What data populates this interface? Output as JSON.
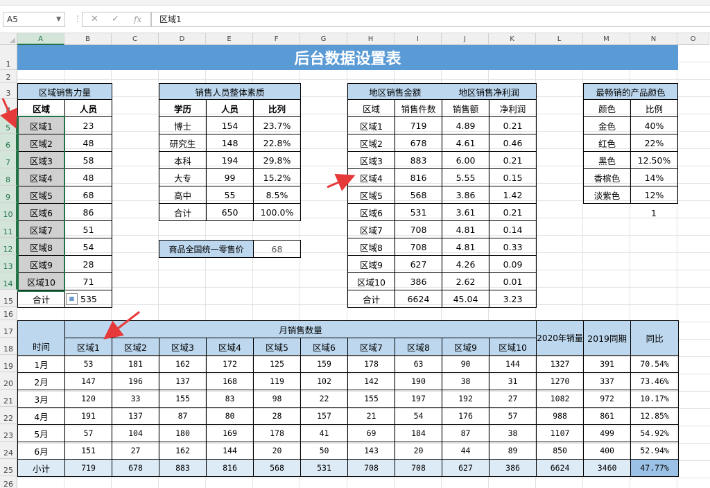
{
  "formula_bar": {
    "name_box": "A5",
    "cancel_icon": "✕",
    "confirm_icon": "✓",
    "fx_icon": "fx",
    "formula": "区域1"
  },
  "columns": [
    "A",
    "B",
    "C",
    "D",
    "E",
    "F",
    "G",
    "H",
    "I",
    "J",
    "K",
    "L",
    "M",
    "N",
    "O"
  ],
  "rows": [
    "1",
    "2",
    "3",
    "4",
    "5",
    "6",
    "7",
    "8",
    "9",
    "10",
    "11",
    "12",
    "13",
    "14",
    "15",
    "16",
    "17",
    "18",
    "19",
    "20",
    "21",
    "22",
    "23",
    "24",
    "25",
    "26"
  ],
  "title": "后台数据设置表",
  "force_table": {
    "title": "区域销售力量",
    "headers": [
      "区域",
      "人员"
    ],
    "rows": [
      [
        "区域1",
        "23"
      ],
      [
        "区域2",
        "48"
      ],
      [
        "区域3",
        "58"
      ],
      [
        "区域4",
        "48"
      ],
      [
        "区域5",
        "68"
      ],
      [
        "区域6",
        "86"
      ],
      [
        "区域7",
        "51"
      ],
      [
        "区域8",
        "54"
      ],
      [
        "区域9",
        "28"
      ],
      [
        "区域10",
        "71"
      ]
    ],
    "total_label": "合计",
    "total": "535"
  },
  "staff_table": {
    "title": "销售人员整体素质",
    "headers": [
      "学历",
      "人员",
      "比列"
    ],
    "rows": [
      [
        "博士",
        "154",
        "23.7%"
      ],
      [
        "研究生",
        "148",
        "22.8%"
      ],
      [
        "本科",
        "194",
        "29.8%"
      ],
      [
        "大专",
        "99",
        "15.2%"
      ],
      [
        "高中",
        "55",
        "8.5%"
      ],
      [
        "合计",
        "650",
        "100.0%"
      ]
    ]
  },
  "price_box": {
    "label": "商品全国统一零售价",
    "value": "68"
  },
  "region_table": {
    "title1": "地区销售金额",
    "title2": "地区销售净利润",
    "headers": [
      "区域",
      "销售件数",
      "销售额",
      "净利润"
    ],
    "rows": [
      [
        "区域1",
        "719",
        "4.89",
        "0.21"
      ],
      [
        "区域2",
        "678",
        "4.61",
        "0.46"
      ],
      [
        "区域3",
        "883",
        "6.00",
        "0.21"
      ],
      [
        "区域4",
        "816",
        "5.55",
        "0.15"
      ],
      [
        "区域5",
        "568",
        "3.86",
        "1.42"
      ],
      [
        "区域6",
        "531",
        "3.61",
        "0.21"
      ],
      [
        "区域7",
        "708",
        "4.81",
        "0.14"
      ],
      [
        "区域8",
        "708",
        "4.81",
        "0.33"
      ],
      [
        "区域9",
        "627",
        "4.26",
        "0.09"
      ],
      [
        "区域10",
        "386",
        "2.62",
        "0.01"
      ],
      [
        "合计",
        "6624",
        "45.04",
        "3.23"
      ]
    ]
  },
  "color_table": {
    "title": "最畅销的产品颜色",
    "headers": [
      "颜色",
      "比例"
    ],
    "rows": [
      [
        "金色",
        "40%"
      ],
      [
        "红色",
        "22%"
      ],
      [
        "黑色",
        "12.50%"
      ],
      [
        "香槟色",
        "14%"
      ],
      [
        "淡紫色",
        "12%"
      ]
    ],
    "extra": "1"
  },
  "monthly_table": {
    "group_header": "月销售数量",
    "time_header": "时间",
    "regions": [
      "区域1",
      "区域2",
      "区域3",
      "区域4",
      "区域5",
      "区域6",
      "区域7",
      "区域8",
      "区域9",
      "区域10"
    ],
    "sales_2020": "2020年销量",
    "same_2019": "2019同期",
    "yoy": "同比",
    "rows": [
      [
        "1月",
        "53",
        "181",
        "162",
        "172",
        "125",
        "159",
        "178",
        "63",
        "90",
        "144",
        "1327",
        "391",
        "70.54%"
      ],
      [
        "2月",
        "147",
        "196",
        "137",
        "168",
        "119",
        "102",
        "142",
        "190",
        "38",
        "31",
        "1270",
        "337",
        "73.46%"
      ],
      [
        "3月",
        "120",
        "33",
        "155",
        "83",
        "98",
        "22",
        "155",
        "197",
        "192",
        "27",
        "1082",
        "972",
        "10.17%"
      ],
      [
        "4月",
        "191",
        "137",
        "87",
        "80",
        "28",
        "157",
        "21",
        "54",
        "176",
        "57",
        "988",
        "861",
        "12.85%"
      ],
      [
        "5月",
        "57",
        "104",
        "180",
        "169",
        "178",
        "41",
        "69",
        "184",
        "87",
        "38",
        "1107",
        "499",
        "54.92%"
      ],
      [
        "6月",
        "151",
        "27",
        "162",
        "144",
        "20",
        "50",
        "143",
        "20",
        "44",
        "89",
        "850",
        "400",
        "52.94%"
      ]
    ],
    "subtotal": [
      "小计",
      "719",
      "678",
      "883",
      "816",
      "568",
      "531",
      "708",
      "708",
      "627",
      "386",
      "6624",
      "3460",
      "47.77%"
    ]
  }
}
